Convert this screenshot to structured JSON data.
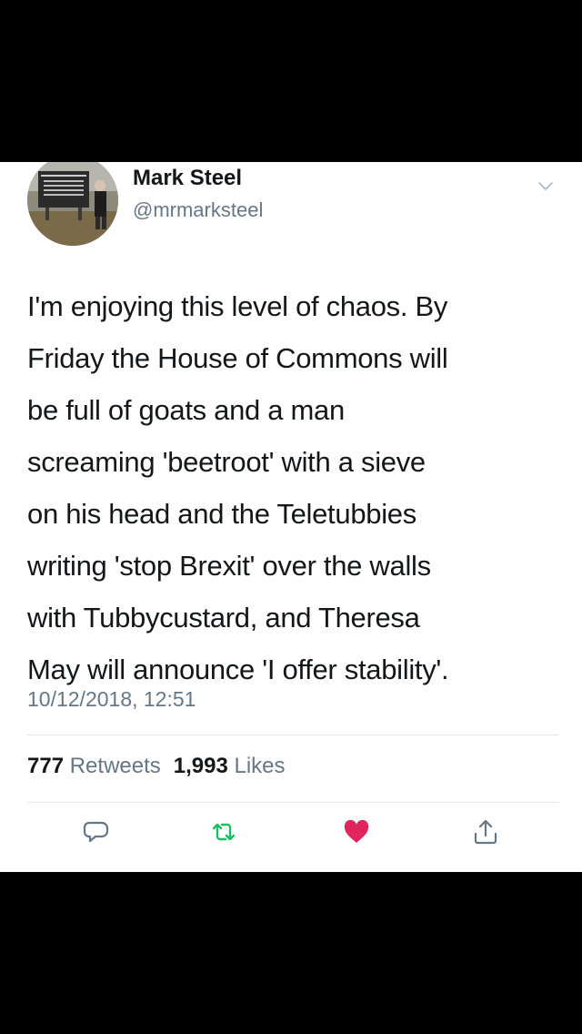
{
  "tweet": {
    "display_name": "Mark Steel",
    "handle": "@mrmarksteel",
    "text": "I'm enjoying this level of chaos. By\nFriday the House of Commons will\nbe full of goats and a man\nscreaming 'beetroot' with a sieve\non his head and the Teletubbies\nwriting 'stop Brexit' over the walls\nwith Tubbycustard, and Theresa\nMay will announce 'I offer stability'.",
    "timestamp": "10/12/2018, 12:51",
    "retweets_count": "777",
    "retweets_label": "Retweets",
    "likes_count": "1,993",
    "likes_label": "Likes"
  },
  "icons": {
    "menu": "chevron-down-icon",
    "reply": "reply-icon",
    "retweet": "retweet-icon",
    "like": "heart-icon",
    "share": "share-icon"
  },
  "colors": {
    "retweet_active": "#17bf63",
    "like_active": "#e0245e",
    "secondary_text": "#657786",
    "primary_text": "#14171a"
  }
}
